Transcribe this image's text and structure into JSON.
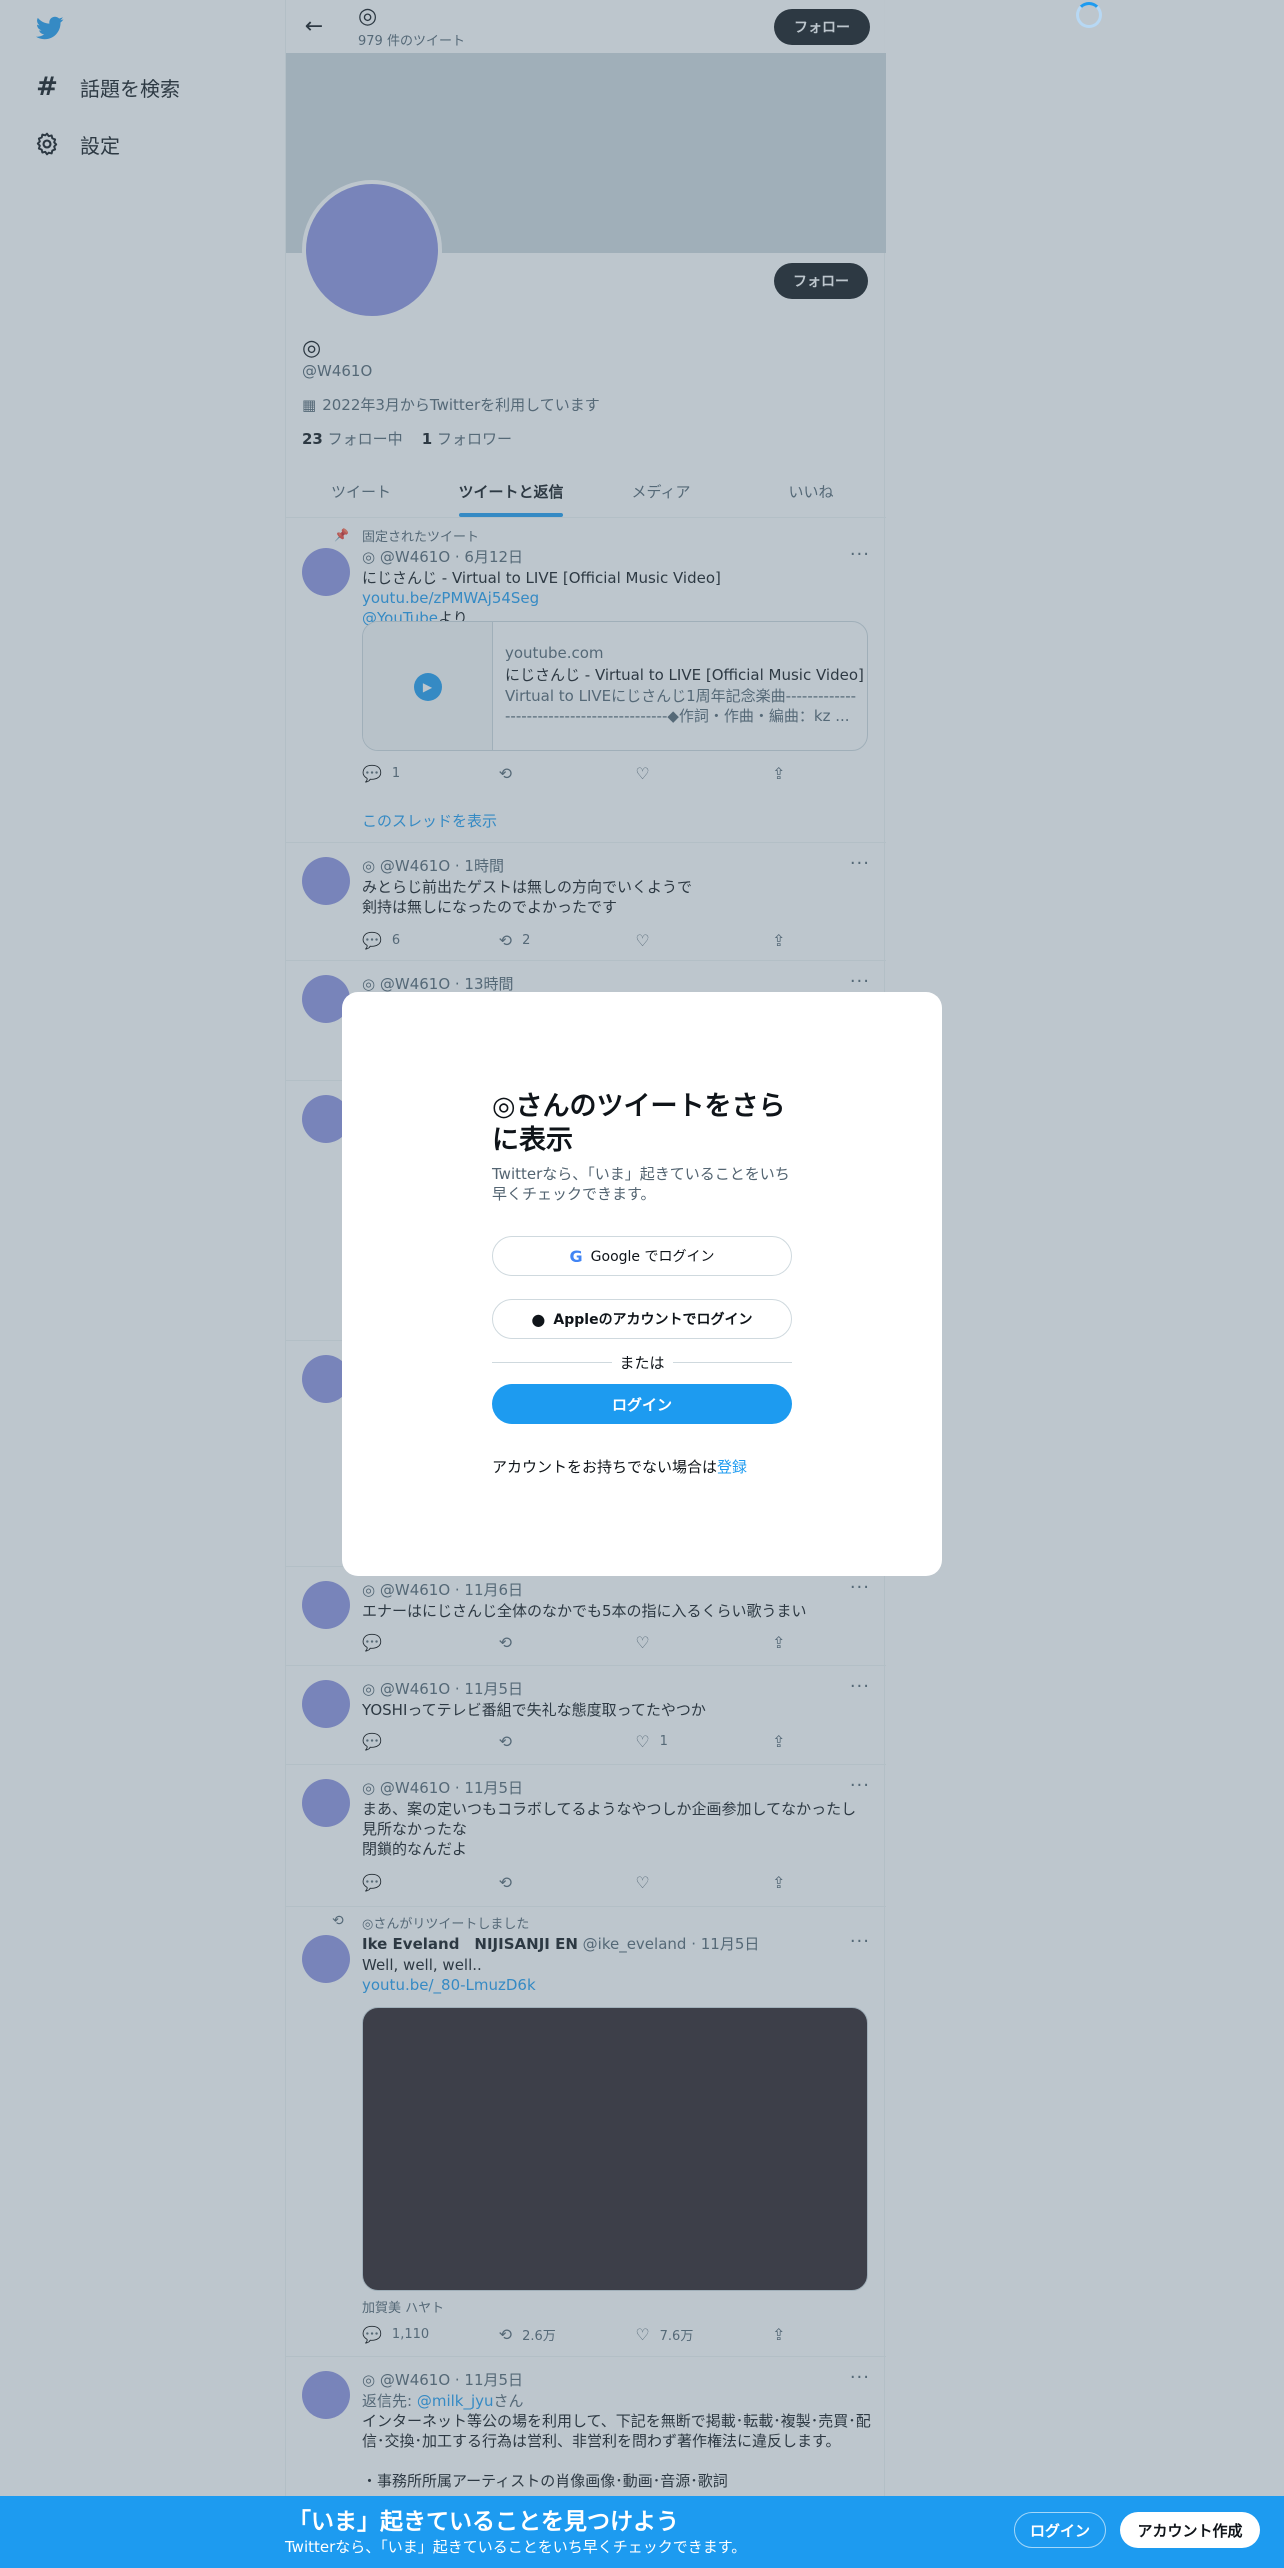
{
  "nav": {
    "explore_label": "話題を検索",
    "settings_label": "設定"
  },
  "topbar": {
    "name": "◎",
    "tweet_count": "979 件のツイート",
    "follow_label": "フォロー"
  },
  "profile": {
    "name": "◎",
    "handle": "@W461O",
    "joined": "2022年3月からTwitterを利用しています",
    "following_count": "23",
    "following_label": "フォロー中",
    "followers_count": "1",
    "followers_label": "フォロワー",
    "follow_label": "フォロー"
  },
  "tabs": [
    "ツイート",
    "ツイートと返信",
    "メディア",
    "いいね"
  ],
  "tweets": {
    "pinned": {
      "pinned_label": "固定されたツイート",
      "head": "◎ @W461O · 6月12日",
      "text_prefix": "にじさんじ - Virtual to LIVE [Official Music Video] ",
      "link1": "youtu.be/zPMWAj54Seg",
      "link2": "@YouTube",
      "text_suffix": "より",
      "card_domain": "youtube.com",
      "card_title": "にじさんじ - Virtual to LIVE [Official Music Video]",
      "card_desc": "Virtual to LIVEにじさんじ1周年記念楽曲-------------------------------------------◆作詞・作曲・編曲：kz ...",
      "replies": "1",
      "retweets": "",
      "likes": "",
      "thread_link": "このスレッドを表示"
    },
    "t2": {
      "head": "◎ @W461O · 1時間",
      "line1": "みとらじ前出たゲストは無しの方向でいくようで",
      "line2": "剣持は無しになったのでよかったです",
      "replies": "6",
      "retweets": "2"
    },
    "t3": {
      "head": "◎ @W461O · 13時間"
    },
    "t4": {
      "head": "◎ @W461O · 11月6日",
      "text": "エナーはにじさんじ全体のなかでも5本の指に入るくらい歌うまい"
    },
    "t5": {
      "head": "◎ @W461O · 11月5日",
      "text": "YOSHIってテレビ番組で失礼な態度取ってたやつか",
      "likes": "1"
    },
    "t6": {
      "head": "◎ @W461O · 11月5日",
      "line1": "まあ、案の定いつもコラボしてるようなやつしか企画参加してなかったし",
      "line2": "見所なかったな",
      "line3": "閉鎖的なんだよ"
    },
    "t7": {
      "rt_label": "◎さんがリツイートしました",
      "author": "Ike Eveland　NIJISANJI EN",
      "meta": "@ike_eveland · 11月5日",
      "text": "Well, well, well..",
      "link": "youtu.be/_80-LmuzD6k",
      "caption": "加賀美 ハヤト",
      "replies": "1,110",
      "retweets": "2.6万",
      "likes": "7.6万"
    },
    "t8": {
      "head": "◎ @W461O · 11月5日",
      "reply_prefix": "返信先: ",
      "reply_handle": "@milk_jyu",
      "reply_suffix": "さん",
      "line1": "インターネット等公の場を利用して、下記を無断で掲載･転載･複製･売買･配",
      "line2": "信･交換･加工する行為は営利、非営利を問わず著作権法に違反します。",
      "line3": "・事務所所属アーティストの肖像画像･動画･音源･歌詞"
    }
  },
  "modal": {
    "title": "◎さんのツイートをさらに表示",
    "subtitle": "Twitterなら、「いま」起きていることをいち早くチェックできます。",
    "google_label": "Google でログイン",
    "apple_label": "Appleのアカウントでログイン",
    "or_label": "または",
    "login_label": "ログイン",
    "signup_prompt": "アカウントをお持ちでない場合は",
    "signup_link": "登録"
  },
  "bottombar": {
    "title": "「いま」起きていることを見つけよう",
    "subtitle": "Twitterなら、「いま」起きていることをいち早くチェックできます。",
    "login_label": "ログイン",
    "signup_label": "アカウント作成"
  },
  "colors": {
    "brand": "#1d9bf0",
    "avatar": "#8d92e0",
    "banner": "#cfd9de"
  }
}
